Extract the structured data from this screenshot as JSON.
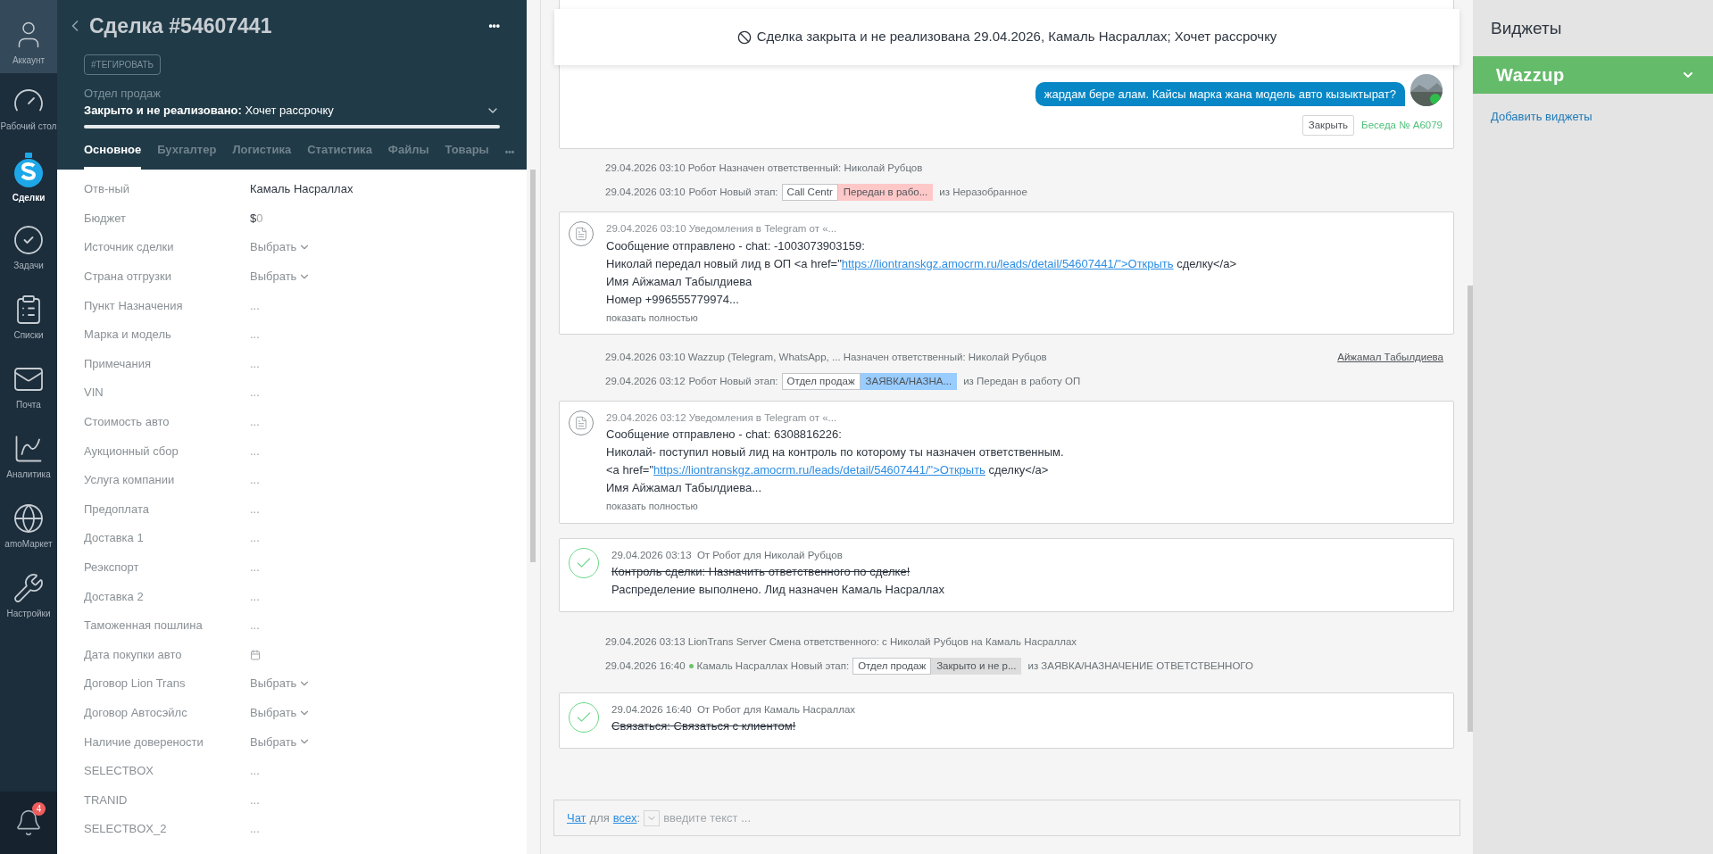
{
  "nav": [
    {
      "label": "Аккаунт",
      "kind": "avatar",
      "selected": false
    },
    {
      "label": "Рабочий стол",
      "kind": "gauge",
      "selected": false
    },
    {
      "label": "Сделки",
      "kind": "deals",
      "selected": true
    },
    {
      "label": "Задачи",
      "kind": "tasks",
      "selected": false
    },
    {
      "label": "Списки",
      "kind": "lists",
      "selected": false
    },
    {
      "label": "Почта",
      "kind": "mail",
      "selected": false
    },
    {
      "label": "Аналитика",
      "kind": "analytics",
      "selected": false
    },
    {
      "label": "amoМаркет",
      "kind": "market",
      "selected": false
    },
    {
      "label": "Настройки",
      "kind": "settings",
      "selected": false
    }
  ],
  "notifications": {
    "badge": "4"
  },
  "deal": {
    "title": "Сделка #54607441",
    "more": "•••",
    "tag_button": "#ТЕГИРОВАТЬ",
    "pipeline": "Отдел продаж",
    "status": "**Закрыто и не реализовано:** Хочет рассрочку",
    "level": 1
  },
  "tabs": [
    {
      "label": "Основное",
      "selected": true
    },
    {
      "label": "Бухгалтер",
      "selected": false
    },
    {
      "label": "Логистика",
      "selected": false
    },
    {
      "label": "Статистика",
      "selected": false
    },
    {
      "label": "Файлы",
      "selected": false
    },
    {
      "label": "Товары",
      "selected": false
    }
  ],
  "tabs_more": "•••",
  "fields": [
    {
      "label": "Отв-ный",
      "kind": "text",
      "value": "Камаль Насраллах"
    },
    {
      "label": "Бюджет",
      "kind": "budget",
      "currency": "$",
      "value": "0"
    },
    {
      "label": "Источник сделки",
      "kind": "select",
      "value": "Выбрать"
    },
    {
      "label": "Страна отгрузки",
      "kind": "select",
      "value": "Выбрать"
    },
    {
      "label": "Пункт Назначения",
      "kind": "empty",
      "value": "..."
    },
    {
      "label": "Марка и модель",
      "kind": "empty",
      "value": "..."
    },
    {
      "label": "Примечания",
      "kind": "empty",
      "value": "..."
    },
    {
      "label": "VIN",
      "kind": "empty",
      "value": "..."
    },
    {
      "label": "Стоимость авто",
      "kind": "empty",
      "value": "..."
    },
    {
      "label": "Аукционный сбор",
      "kind": "empty",
      "value": "..."
    },
    {
      "label": "Услуга компании",
      "kind": "empty",
      "value": "..."
    },
    {
      "label": "Предоплата",
      "kind": "empty",
      "value": "..."
    },
    {
      "label": "Доставка 1",
      "kind": "empty",
      "value": "..."
    },
    {
      "label": "Реэкспорт",
      "kind": "empty",
      "value": "..."
    },
    {
      "label": "Доставка 2",
      "kind": "empty",
      "value": "..."
    },
    {
      "label": "Таможенная пошлина",
      "kind": "empty",
      "value": "..."
    },
    {
      "label": "Дата покупки авто",
      "kind": "date"
    },
    {
      "label": "Договор Lion Trans",
      "kind": "select",
      "value": "Выбрать"
    },
    {
      "label": "Договор Автосэйлс",
      "kind": "select",
      "value": "Выбрать"
    },
    {
      "label": "Наличие доверености",
      "kind": "select",
      "value": "Выбрать"
    },
    {
      "label": "SELECTBOX",
      "kind": "empty",
      "value": "..."
    },
    {
      "label": "TRANID",
      "kind": "empty",
      "value": "..."
    },
    {
      "label": "SELECTBOX_2",
      "kind": "empty",
      "value": "..."
    }
  ],
  "banner": {
    "text": "Сделка закрыта и не реализована 29.04.2026, Камаль Насраллах; Хочет рассрочку"
  },
  "events": [
    {
      "kind": "chat",
      "bubble": "жардам бере алам. Кайсы марка жана модель авто кызыктырат?",
      "close_button": "Закрыть",
      "conversation": "Беседа № A6079"
    },
    {
      "kind": "note",
      "time": "29.04.2026 03:10",
      "author": "Робот",
      "text": "Назначен ответственный: Николай Рубцов"
    },
    {
      "kind": "stage",
      "time": "29.04.2026 03:10",
      "author": "Робот",
      "online": false,
      "label": "Новый этап:",
      "pipeline": "Call Centr",
      "stage": "Передан в рабо...",
      "color": "#ffc8c8",
      "from": "из Неразобранное"
    },
    {
      "kind": "message",
      "header": "29.04.2026 03:10 Уведомления в Telegram от «...",
      "lines": [
        {
          "text": "Сообщение отправлено - chat: -1003073903159:"
        },
        {
          "text": "Николай передал новый лид в ОП <a href=\"",
          "link": "https://liontranskgz.amocrm.ru/leads/detail/54607441/\">Открыть",
          "after": " сделку</a>"
        },
        {
          "text": "Имя Айжамал Табылдиева"
        },
        {
          "text": "Номер +996555779974..."
        }
      ],
      "more": "показать полностью"
    },
    {
      "kind": "note",
      "time": "29.04.2026 03:10",
      "author": "Wazzup (Telegram, WhatsApp, ...",
      "text": "Назначен ответственный: Николай Рубцов",
      "contact": "Айжамал Табылдиева"
    },
    {
      "kind": "stage",
      "time": "29.04.2026 03:12",
      "author": "Робот",
      "online": false,
      "label": "Новый этап:",
      "pipeline": "Отдел продаж",
      "stage": "ЗАЯВКА/НАЗНА...",
      "color": "#99ccff",
      "from": "из Передан в работу ОП"
    },
    {
      "kind": "message",
      "header": "29.04.2026 03:12 Уведомления в Telegram от «...",
      "lines": [
        {
          "text": "Сообщение отправлено - chat: 6308816226:"
        },
        {
          "text": "Николай- поступил новый лид на контроль по которому ты назначен ответственным."
        },
        {
          "text": "<a href=\"",
          "link": "https://liontranskgz.amocrm.ru/leads/detail/54607441/\">Открыть",
          "after": " сделку</a>"
        },
        {
          "text": "Имя Айжамал Табылдиева..."
        }
      ],
      "more": "показать полностью"
    },
    {
      "kind": "task",
      "time": "29.04.2026 03:13",
      "from": "От Робот для Николай Рубцов",
      "lines": [
        {
          "text": "Контроль сделки: Назначить ответственного по сделке!",
          "done": true
        },
        {
          "text": "Распределение выполнено. Лид назначен Камаль Насраллах",
          "done": false
        }
      ]
    },
    {
      "kind": "note",
      "time": "29.04.2026 03:13",
      "author": "LionTrans Server",
      "text": "Смена ответственного: с Николай Рубцов на Камаль Насраллах"
    },
    {
      "kind": "stage",
      "time": "29.04.2026 16:40",
      "author": "Камаль Насраллах",
      "online": true,
      "label": "Новый этап:",
      "pipeline": "Отдел продаж",
      "stage": "Закрыто и не р...",
      "color": "#dddddd",
      "from": "из ЗАЯВКА/НАЗНАЧЕНИЕ ОТВЕТСТВЕННОГО"
    },
    {
      "kind": "task",
      "time": "29.04.2026 16:40",
      "from": "От Робот для Камаль Насраллах",
      "lines": [
        {
          "text": "Связаться: Связаться с клиентом!",
          "done": true
        }
      ]
    }
  ],
  "chat_input": {
    "chat_link": "Чат",
    "for": "для",
    "all_link": "всех",
    "colon": ":",
    "placeholder": "введите текст ..."
  },
  "widgets": {
    "title": "Виджеты",
    "items": [
      {
        "name": "Wazzup",
        "expanded": false
      }
    ],
    "add_link": "Добавить виджеты"
  }
}
